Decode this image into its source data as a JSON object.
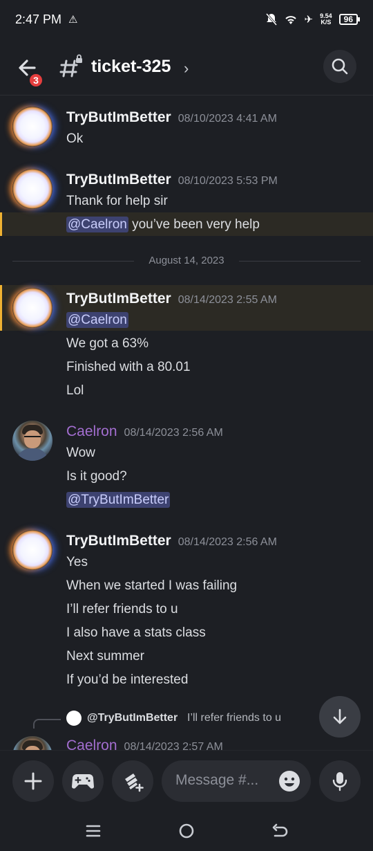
{
  "status": {
    "time": "2:47 PM",
    "speed_value": "9.54",
    "speed_unit": "K/S",
    "battery": "96"
  },
  "header": {
    "back_badge": "3",
    "channel_name": "ticket-325"
  },
  "messages": [
    {
      "author": "TryButImBetter",
      "timestamp": "08/10/2023 4:41 AM",
      "lines": [
        "Ok"
      ]
    },
    {
      "author": "TryButImBetter",
      "timestamp": "08/10/2023 5:53 PM",
      "lines": [
        "Thank for help sir"
      ],
      "mention_line": {
        "mention": "@Caelron",
        "text": " you’ve been very help"
      }
    },
    {
      "author": "TryButImBetter",
      "timestamp": "08/14/2023 2:55 AM",
      "mention": "@Caelron",
      "lines": [
        "We got a 63%",
        "Finished with a 80.01",
        "Lol"
      ]
    },
    {
      "author": "Caelron",
      "timestamp": "08/14/2023 2:56 AM",
      "lines": [
        "Wow",
        "Is it good?"
      ],
      "mention": "@TryButImBetter"
    },
    {
      "author": "TryButImBetter",
      "timestamp": "08/14/2023 2:56 AM",
      "lines": [
        "Yes",
        "When we started I was failing",
        "I’ll refer friends to u",
        "I also have a stats class",
        "Next summer",
        "If you’d be interested"
      ]
    },
    {
      "author": "Caelron",
      "timestamp": "08/14/2023 2:57 AM"
    }
  ],
  "date_divider": "August 14, 2023",
  "reply_preview": {
    "name": "@TryButImBetter",
    "text": "I’ll refer friends to u"
  },
  "composer": {
    "placeholder": "Message #..."
  },
  "colors": {
    "background": "#1d1f24",
    "mention_bg": "#3d4270",
    "highlight_border": "#f0b232",
    "caelron_name": "#a36ed0",
    "badge": "#e53e3e"
  }
}
